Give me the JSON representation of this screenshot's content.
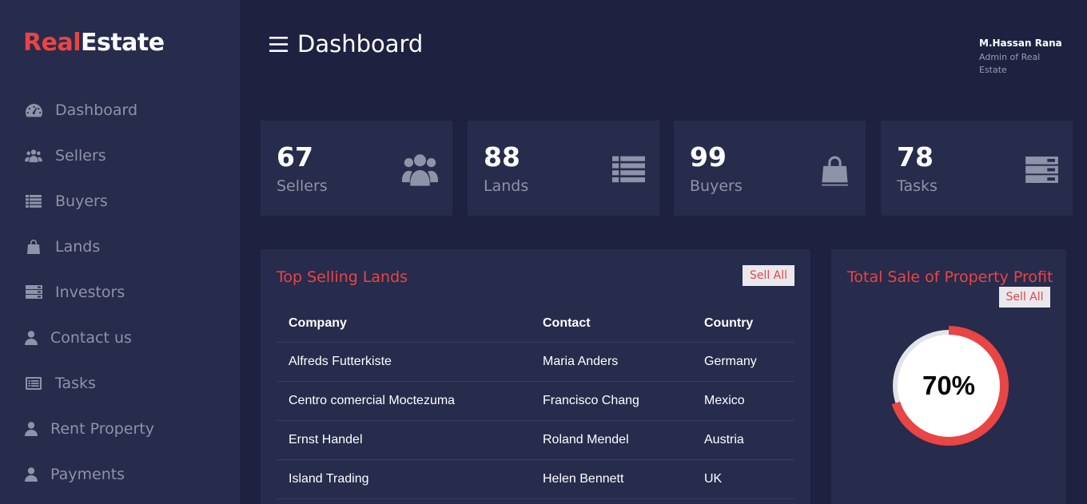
{
  "brand": {
    "part1": "Real",
    "part2": "Estate"
  },
  "sidebar": {
    "items": [
      {
        "label": "Dashboard",
        "icon": "dashboard-icon"
      },
      {
        "label": "Sellers",
        "icon": "users-icon"
      },
      {
        "label": "Buyers",
        "icon": "list-icon"
      },
      {
        "label": "Lands",
        "icon": "shopping-bag-icon"
      },
      {
        "label": "Investors",
        "icon": "server-icon"
      },
      {
        "label": "Contact us",
        "icon": "user-icon"
      },
      {
        "label": "Tasks",
        "icon": "list-alt-icon"
      },
      {
        "label": "Rent Property",
        "icon": "user-icon"
      },
      {
        "label": "Payments",
        "icon": "user-icon"
      }
    ]
  },
  "header": {
    "title": "Dashboard",
    "user_name": "M.Hassan Rana",
    "user_role": "Admin of Real Estate"
  },
  "stats": [
    {
      "value": "67",
      "label": "Sellers",
      "icon": "users-icon"
    },
    {
      "value": "88",
      "label": "Lands",
      "icon": "list-icon"
    },
    {
      "value": "99",
      "label": "Buyers",
      "icon": "shopping-bag-icon"
    },
    {
      "value": "78",
      "label": "Tasks",
      "icon": "server-icon"
    }
  ],
  "top_selling": {
    "title": "Top Selling Lands",
    "button": "Sell All",
    "columns": [
      "Company",
      "Contact",
      "Country"
    ],
    "rows": [
      [
        "Alfreds Futterkiste",
        "Maria Anders",
        "Germany"
      ],
      [
        "Centro comercial Moctezuma",
        "Francisco Chang",
        "Mexico"
      ],
      [
        "Ernst Handel",
        "Roland Mendel",
        "Austria"
      ],
      [
        "Island Trading",
        "Helen Bennett",
        "UK"
      ]
    ]
  },
  "profit": {
    "title": "Total Sale of Property Profit",
    "button": "Sell All",
    "percent": 70,
    "percent_label": "70%"
  },
  "colors": {
    "accent": "#e84545",
    "background": "#1e2140",
    "panel": "#272b4c",
    "muted": "#8f93a8"
  }
}
